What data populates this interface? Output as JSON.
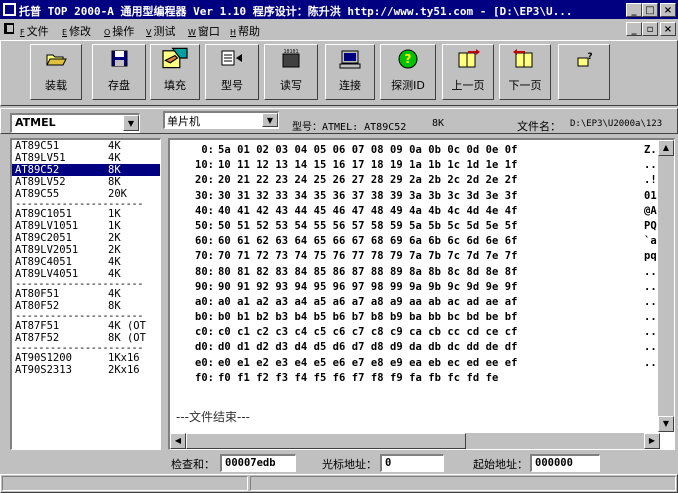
{
  "window": {
    "title": "托普 TOP 2000-A  通用型编程器 Ver 1.10   程序设计：陈升洪  http://www.ty51.com - [D:\\EP3\\U...",
    "minimize": "_",
    "maximize": "□",
    "close": "×",
    "child_minimize": "_",
    "child_restore": "▫",
    "child_close": "×"
  },
  "menu": [
    {
      "key": "F",
      "label": "文件"
    },
    {
      "key": "E",
      "label": "修改"
    },
    {
      "key": "O",
      "label": "操作"
    },
    {
      "key": "V",
      "label": "测试"
    },
    {
      "key": "W",
      "label": "窗口"
    },
    {
      "key": "H",
      "label": "帮助"
    }
  ],
  "toolbar": {
    "load": "装载",
    "save": "存盘",
    "fill": "填充",
    "model": "型号",
    "readwrite": "读写",
    "connect": "连接",
    "probe": "探测ID",
    "prev": "上一页",
    "next": "下一页",
    "rw_icon_text": "10101"
  },
  "selectors": {
    "manufacturer": "ATMEL",
    "device_type": "单片机",
    "model_info": "型号：ATMEL:  AT89C52",
    "size_info": "8K",
    "filename_label": "文件名：",
    "filename_value": "D:\\EP3\\U2000a\\123"
  },
  "devices": [
    {
      "name": "AT89C51",
      "size": "4K"
    },
    {
      "name": "AT89LV51",
      "size": "4K"
    },
    {
      "name": "AT89C52",
      "size": "8K",
      "selected": true
    },
    {
      "name": "AT89LV52",
      "size": "8K"
    },
    {
      "name": "AT89C55",
      "size": "20K"
    },
    {
      "sep": "----------------------"
    },
    {
      "name": "AT89C1051",
      "size": "1K"
    },
    {
      "name": "AT89LV1051",
      "size": "1K"
    },
    {
      "name": "AT89C2051",
      "size": "2K"
    },
    {
      "name": "AT89LV2051",
      "size": "2K"
    },
    {
      "name": "AT89C4051",
      "size": "4K"
    },
    {
      "name": "AT89LV4051",
      "size": "4K"
    },
    {
      "sep": "----------------------"
    },
    {
      "name": "AT80F51",
      "size": "4K"
    },
    {
      "name": "AT80F52",
      "size": "8K"
    },
    {
      "sep": "----------------------"
    },
    {
      "name": "AT87F51",
      "size": "4K (OT"
    },
    {
      "name": "AT87F52",
      "size": "8K (OT"
    },
    {
      "sep": "----------------------"
    },
    {
      "name": "AT90S1200",
      "size": "1Kx16"
    },
    {
      "name": "AT90S2313",
      "size": "2Kx16"
    }
  ],
  "hex_rows": [
    {
      "addr": "0:",
      "bytes": "5a 01 02 03 04 05 06 07 08 09 0a 0b 0c 0d 0e 0f",
      "ascii": "Z."
    },
    {
      "addr": "10:",
      "bytes": "10 11 12 13 14 15 16 17 18 19 1a 1b 1c 1d 1e 1f",
      "ascii": ".."
    },
    {
      "addr": "20:",
      "bytes": "20 21 22 23 24 25 26 27 28 29 2a 2b 2c 2d 2e 2f",
      "ascii": ".!"
    },
    {
      "addr": "30:",
      "bytes": "30 31 32 33 34 35 36 37 38 39 3a 3b 3c 3d 3e 3f",
      "ascii": "01"
    },
    {
      "addr": "40:",
      "bytes": "40 41 42 43 44 45 46 47 48 49 4a 4b 4c 4d 4e 4f",
      "ascii": "@A"
    },
    {
      "addr": "50:",
      "bytes": "50 51 52 53 54 55 56 57 58 59 5a 5b 5c 5d 5e 5f",
      "ascii": "PQ"
    },
    {
      "addr": "60:",
      "bytes": "60 61 62 63 64 65 66 67 68 69 6a 6b 6c 6d 6e 6f",
      "ascii": "`a"
    },
    {
      "addr": "70:",
      "bytes": "70 71 72 73 74 75 76 77 78 79 7a 7b 7c 7d 7e 7f",
      "ascii": "pq"
    },
    {
      "addr": "80:",
      "bytes": "80 81 82 83 84 85 86 87 88 89 8a 8b 8c 8d 8e 8f",
      "ascii": ".."
    },
    {
      "addr": "90:",
      "bytes": "90 91 92 93 94 95 96 97 98 99 9a 9b 9c 9d 9e 9f",
      "ascii": ".."
    },
    {
      "addr": "a0:",
      "bytes": "a0 a1 a2 a3 a4 a5 a6 a7 a8 a9 aa ab ac ad ae af",
      "ascii": ".."
    },
    {
      "addr": "b0:",
      "bytes": "b0 b1 b2 b3 b4 b5 b6 b7 b8 b9 ba bb bc bd be bf",
      "ascii": ".."
    },
    {
      "addr": "c0:",
      "bytes": "c0 c1 c2 c3 c4 c5 c6 c7 c8 c9 ca cb cc cd ce cf",
      "ascii": ".."
    },
    {
      "addr": "d0:",
      "bytes": "d0 d1 d2 d3 d4 d5 d6 d7 d8 d9 da db dc dd de df",
      "ascii": ".."
    },
    {
      "addr": "e0:",
      "bytes": "e0 e1 e2 e3 e4 e5 e6 e7 e8 e9 ea eb ec ed ee ef",
      "ascii": ".."
    },
    {
      "addr": "f0:",
      "bytes": "f0 f1 f2 f3 f4 f5 f6 f7 f8 f9 fa fb fc fd fe",
      "ascii": ""
    }
  ],
  "hex_end": "---文件结束---",
  "status": {
    "checksum_label": "检查和：",
    "checksum_value": "00007edb",
    "cursor_label": "光标地址：",
    "cursor_value": "0",
    "start_label": "起始地址：",
    "start_value": "000000"
  },
  "colors": {
    "title_bg": "#000080",
    "face": "#c0c0c0",
    "selection": "#000080"
  }
}
